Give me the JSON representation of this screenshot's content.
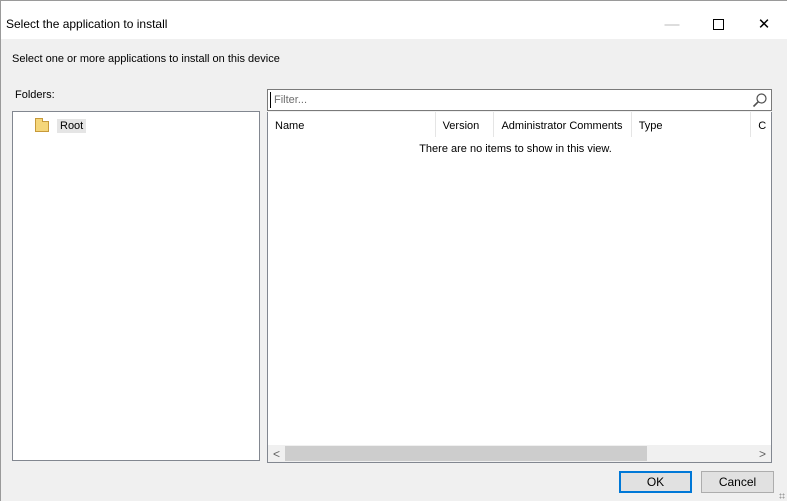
{
  "window": {
    "title": "Select the application to install",
    "minimize_glyph": "—",
    "close_glyph": "✕"
  },
  "instruction": "Select one or more applications to install on this device",
  "folders": {
    "label": "Folders:",
    "tree": [
      {
        "label": "Root",
        "icon": "folder-icon",
        "selected": true
      }
    ]
  },
  "filter": {
    "placeholder": "Filter...",
    "value": "",
    "icon": "search-icon"
  },
  "list": {
    "columns": [
      "Name",
      "Version",
      "Administrator Comments",
      "Type",
      "C"
    ],
    "rows": [],
    "empty_message": "There are no items to show in this view.",
    "scroll_left": "<",
    "scroll_right": ">"
  },
  "buttons": {
    "ok": "OK",
    "cancel": "Cancel"
  },
  "colors": {
    "accent": "#0078d7",
    "folder": "#f5d67a"
  }
}
